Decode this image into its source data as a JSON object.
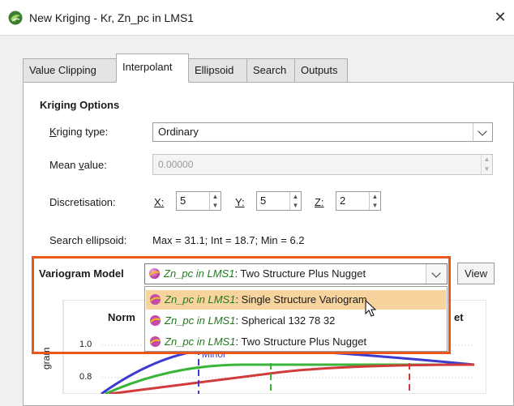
{
  "window": {
    "title": "New Kriging - Kr, Zn_pc in LMS1",
    "close": "✕"
  },
  "tabs": [
    {
      "label": "Value Clipping"
    },
    {
      "label": "Interpolant",
      "active": true
    },
    {
      "label": "Ellipsoid"
    },
    {
      "label": "Search"
    },
    {
      "label": "Outputs"
    }
  ],
  "kriging_options": {
    "section_title": "Kriging Options",
    "kriging_type": {
      "label_prefix": "K",
      "label_rest": "riging type:",
      "value": "Ordinary"
    },
    "mean_value": {
      "label_prefix": "Mean ",
      "label_underline": "v",
      "label_rest": "alue:",
      "value": "0.00000"
    },
    "discretisation": {
      "label": "Discretisation:",
      "x_label": "X:",
      "x_value": "5",
      "y_label": "Y:",
      "y_value": "5",
      "z_label": "Z:",
      "z_value": "2"
    },
    "search_ellipsoid": {
      "label": "Search ellipsoid:",
      "value": "Max = 31.1; Int = 18.7; Min = 6.2"
    }
  },
  "variogram_model": {
    "label": "Variogram Model",
    "selected": {
      "source": "Zn_pc in LMS1",
      "name": ": Two Structure Plus Nugget"
    },
    "view_button": "View",
    "options": [
      {
        "source": "Zn_pc in LMS1",
        "name": ": Single Structure Variogram",
        "highlighted": true
      },
      {
        "source": "Zn_pc in LMS1",
        "name": ": Spherical 132 78 32"
      },
      {
        "source": "Zn_pc in LMS1",
        "name": ": Two Structure Plus Nugget"
      }
    ]
  },
  "chart_partial": {
    "title_fragment_left": "Norm",
    "title_fragment_right": "et",
    "ylabel_fragment": "gram",
    "tick_labels": [
      "1.0",
      "0.8"
    ],
    "series_label": "Minor"
  },
  "colors": {
    "highlight_frame": "#e9561e",
    "dropdown_highlight": "#f7d49d",
    "source_text": "#1f7a1f"
  }
}
